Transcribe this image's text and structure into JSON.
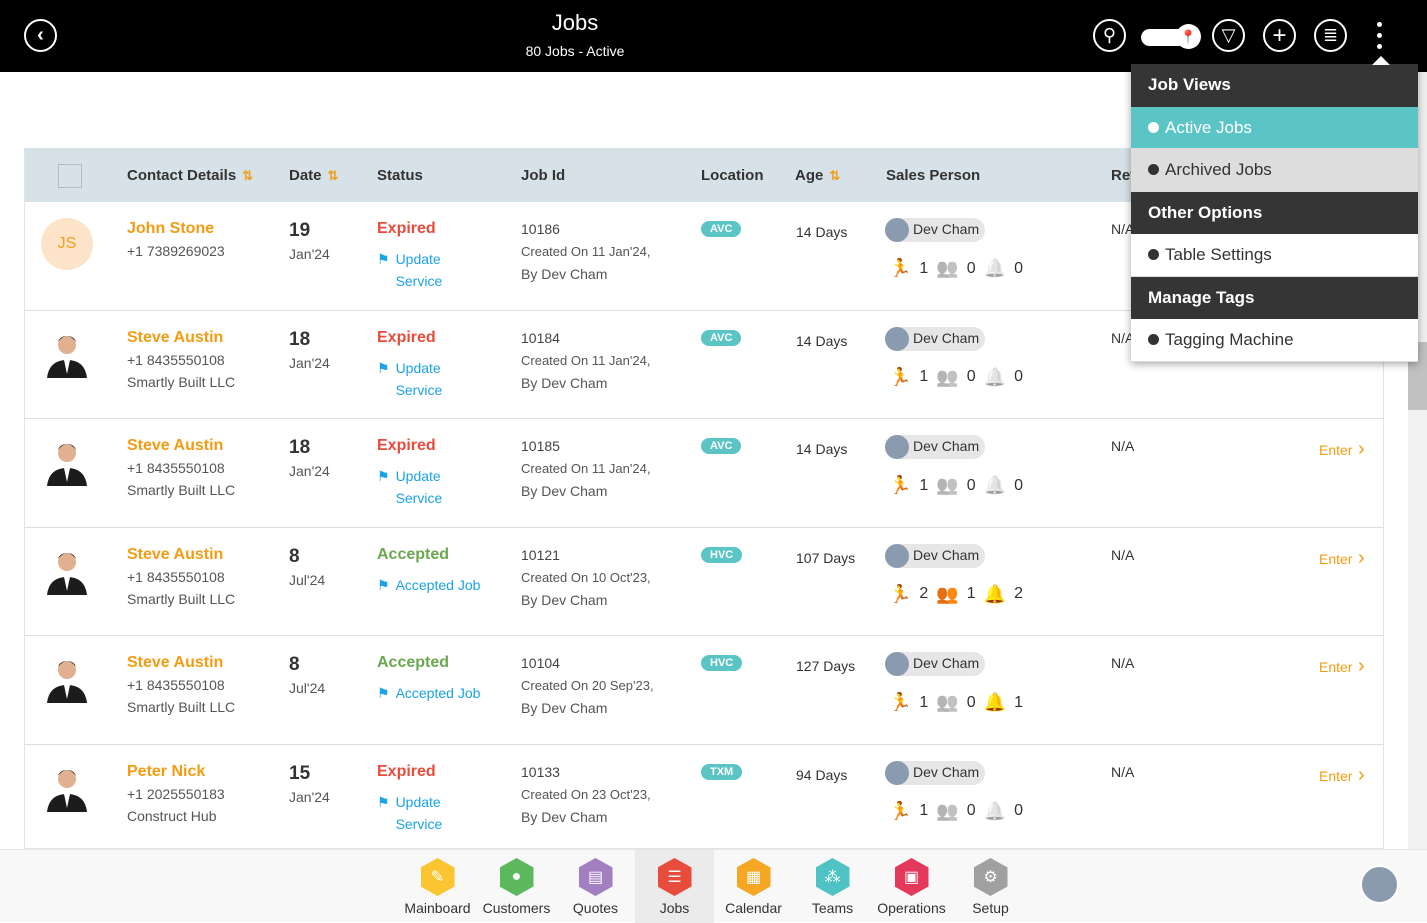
{
  "header": {
    "title": "Jobs",
    "subtitle": "80 Jobs - Active"
  },
  "table": {
    "columns": [
      "Contact Details",
      "Date",
      "Status",
      "Job Id",
      "Location",
      "Age",
      "Sales Person",
      "Ref"
    ],
    "rows": [
      {
        "initials": "JS",
        "name": "John Stone",
        "phone": "+1 7389269023",
        "company": "",
        "day": "19",
        "month": "Jan'24",
        "status": "Expired",
        "action": "Update Service",
        "job_id": "10186",
        "created": "Created On 11 Jan'24,",
        "by": "By Dev Cham",
        "location": "AVC",
        "age": "14 Days",
        "sales_person": "Dev Cham",
        "stats": [
          1,
          0,
          0
        ],
        "ref": "N/A",
        "enter": ""
      },
      {
        "initials": "",
        "name": "Steve Austin",
        "phone": "+1 8435550108",
        "company": "Smartly Built LLC",
        "day": "18",
        "month": "Jan'24",
        "status": "Expired",
        "action": "Update Service",
        "job_id": "10184",
        "created": "Created On 11 Jan'24,",
        "by": "By Dev Cham",
        "location": "AVC",
        "age": "14 Days",
        "sales_person": "Dev Cham",
        "stats": [
          1,
          0,
          0
        ],
        "ref": "N/A",
        "enter": ""
      },
      {
        "initials": "",
        "name": "Steve Austin",
        "phone": "+1 8435550108",
        "company": "Smartly Built LLC",
        "day": "18",
        "month": "Jan'24",
        "status": "Expired",
        "action": "Update Service",
        "job_id": "10185",
        "created": "Created On 11 Jan'24,",
        "by": "By Dev Cham",
        "location": "AVC",
        "age": "14 Days",
        "sales_person": "Dev Cham",
        "stats": [
          1,
          0,
          0
        ],
        "ref": "N/A",
        "enter": "Enter"
      },
      {
        "initials": "",
        "name": "Steve Austin",
        "phone": "+1 8435550108",
        "company": "Smartly Built LLC",
        "day": "8",
        "month": "Jul'24",
        "status": "Accepted",
        "action": "Accepted Job",
        "job_id": "10121",
        "created": "Created On 10 Oct'23,",
        "by": "By Dev Cham",
        "location": "HVC",
        "age": "107 Days",
        "sales_person": "Dev Cham",
        "stats": [
          2,
          1,
          2
        ],
        "ref": "N/A",
        "enter": "Enter"
      },
      {
        "initials": "",
        "name": "Steve Austin",
        "phone": "+1 8435550108",
        "company": "Smartly Built LLC",
        "day": "8",
        "month": "Jul'24",
        "status": "Accepted",
        "action": "Accepted Job",
        "job_id": "10104",
        "created": "Created On 20 Sep'23,",
        "by": "By Dev Cham",
        "location": "HVC",
        "age": "127 Days",
        "sales_person": "Dev Cham",
        "stats": [
          1,
          0,
          1
        ],
        "ref": "N/A",
        "enter": "Enter"
      },
      {
        "initials": "",
        "name": "Peter Nick",
        "phone": "+1 2025550183",
        "company": "Construct Hub",
        "day": "15",
        "month": "Jan'24",
        "status": "Expired",
        "action": "Update Service",
        "job_id": "10133",
        "created": "Created On 23 Oct'23,",
        "by": "By Dev Cham",
        "location": "TXM",
        "age": "94 Days",
        "sales_person": "Dev Cham",
        "stats": [
          1,
          0,
          0
        ],
        "ref": "N/A",
        "enter": "Enter"
      }
    ]
  },
  "menu": {
    "job_views": "Job Views",
    "active_jobs": "Active Jobs",
    "archived_jobs": "Archived Jobs",
    "other_options": "Other Options",
    "table_settings": "Table Settings",
    "manage_tags": "Manage Tags",
    "tagging_machine": "Tagging Machine"
  },
  "nav": [
    {
      "label": "Mainboard",
      "color": "#fbc531",
      "icon": "✎"
    },
    {
      "label": "Customers",
      "color": "#5cb85c",
      "icon": "●"
    },
    {
      "label": "Quotes",
      "color": "#a17fc1",
      "icon": "▤"
    },
    {
      "label": "Jobs",
      "color": "#e74c3c",
      "icon": "☰",
      "active": true
    },
    {
      "label": "Calendar",
      "color": "#f5a623",
      "icon": "▦"
    },
    {
      "label": "Teams",
      "color": "#4fc3c3",
      "icon": "⁂"
    },
    {
      "label": "Operations",
      "color": "#e5395b",
      "icon": "▣"
    },
    {
      "label": "Setup",
      "color": "#a0a0a0",
      "icon": "⚙"
    }
  ],
  "colors": {
    "accent": "#f39c12",
    "teal": "#5bc4c4",
    "expired": "#e74c3c",
    "accepted": "#6aa84f",
    "link": "#1aa3e8"
  }
}
